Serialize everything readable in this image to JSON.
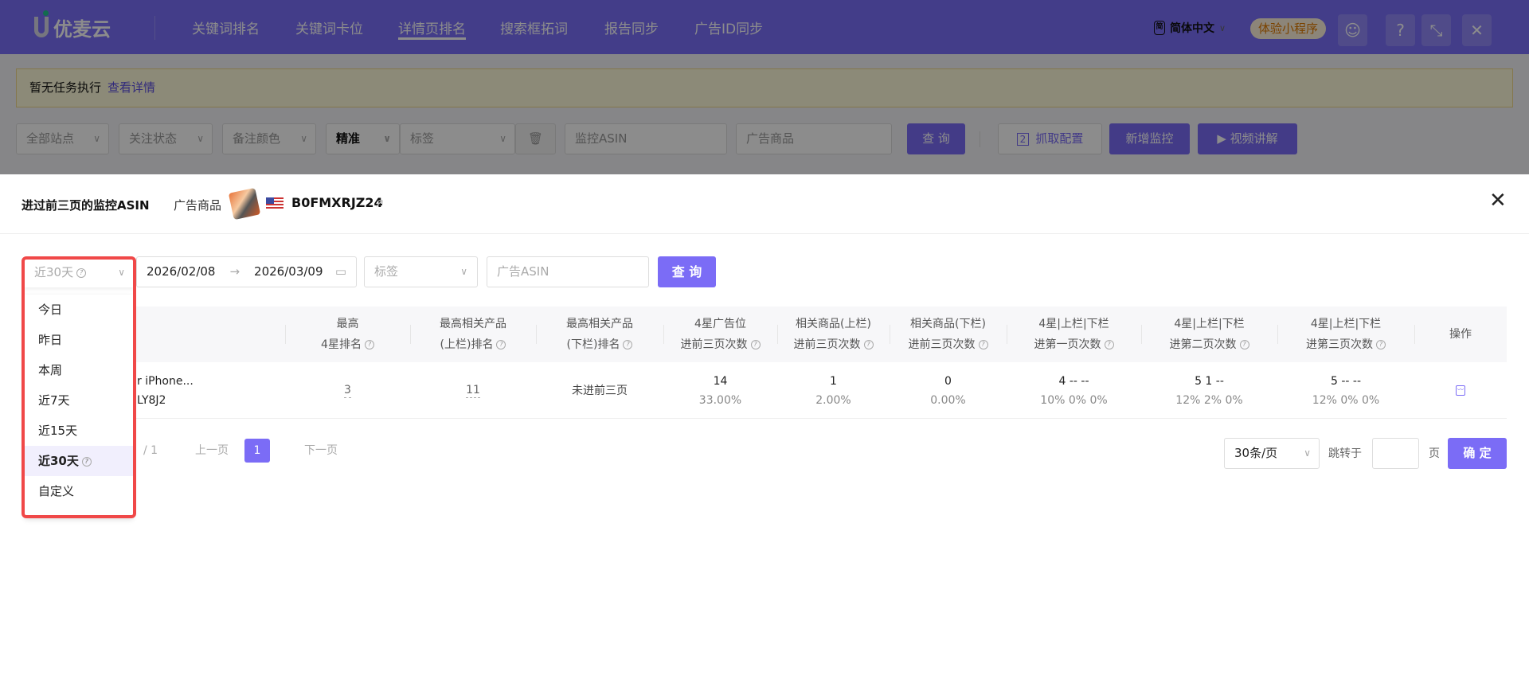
{
  "header": {
    "logo": "优麦云",
    "nav": [
      "关键词排名",
      "关键词卡位",
      "详情页排名",
      "搜索框拓词",
      "报告同步",
      "广告ID同步"
    ],
    "active_nav": 2,
    "language": "简体中文",
    "language_icon": "简",
    "mini_program": "体验小程序",
    "icons": [
      "user-icon",
      "help-icon",
      "collapse-icon",
      "close-icon"
    ]
  },
  "notice": {
    "text": "暂无任务执行",
    "link": "查看详情"
  },
  "filters": {
    "site": "全部站点",
    "follow": "关注状态",
    "color": "备注颜色",
    "match": "精准",
    "tag": "标签",
    "monitor_asin_ph": "监控ASIN",
    "ad_product_ph": "广告商品",
    "query": "查 询",
    "fetch_config": "抓取配置",
    "fetch_config_icon": "2",
    "add_monitor": "新增监控",
    "video": "视频讲解"
  },
  "modal": {
    "title": "进过前三页的监控ASIN",
    "ad_label": "广告商品",
    "asin": "B0FMXRJZ24",
    "range": "近30天",
    "date_start": "2026/02/08",
    "date_end": "2026/03/09",
    "tag_ph": "标签",
    "ad_asin_ph": "广告ASIN",
    "query": "查 询",
    "dropdown": [
      "今日",
      "昨日",
      "本周",
      "近7天",
      "近15天",
      "近30天",
      "自定义"
    ],
    "dropdown_selected": 5,
    "columns": [
      [
        "最高",
        "4星排名"
      ],
      [
        "最高相关产品",
        "(上栏)排名"
      ],
      [
        "最高相关产品",
        "(下栏)排名"
      ],
      [
        "4星广告位",
        "进前三页次数"
      ],
      [
        "相关商品(上栏)",
        "进前三页次数"
      ],
      [
        "相关商品(下栏)",
        "进前三页次数"
      ],
      [
        "4星|上栏|下栏",
        "进第一页次数"
      ],
      [
        "4星|上栏|下栏",
        "进第二页次数"
      ],
      [
        "4星|上栏|下栏",
        "进第三页次数"
      ],
      [
        "操作",
        ""
      ]
    ],
    "row": {
      "product": "r iPhone...",
      "asin": "LY8J2",
      "c1": "3",
      "c2": "11",
      "c3": "未进前三页",
      "c4": [
        "14",
        "33.00%"
      ],
      "c5": [
        "1",
        "2.00%"
      ],
      "c6": [
        "0",
        "0.00%"
      ],
      "c7": [
        "4 -- --",
        "10% 0% 0%"
      ],
      "c8": [
        "5 1 --",
        "12% 2% 0%"
      ],
      "c9": [
        "5 -- --",
        "12% 0% 0%"
      ]
    },
    "pagination": {
      "total_pages": "/ 1",
      "prev": "上一页",
      "current": "1",
      "next": "下一页",
      "page_size": "30条/页",
      "jump_label": "跳转于",
      "page_unit": "页",
      "confirm": "确 定"
    }
  }
}
